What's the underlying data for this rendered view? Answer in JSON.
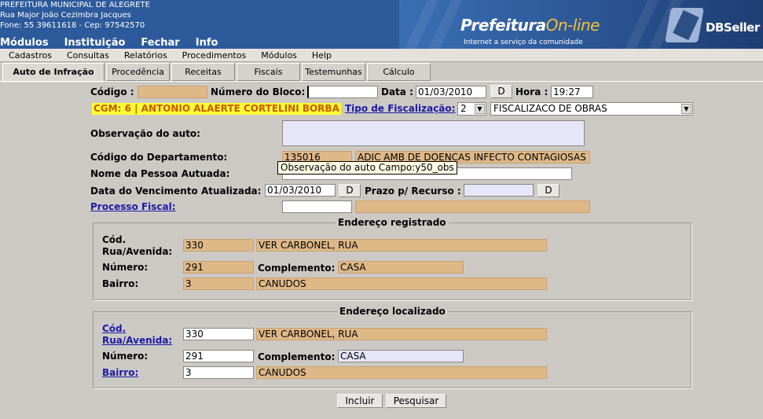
{
  "institution": {
    "name": "PREFEITURA MUNICIPAL DE ALEGRETE",
    "address": "Rua Major João Cezimbra Jacques",
    "contact": "Fone: 55 39611618  -  Cep: 97542570"
  },
  "banner": {
    "logo_main": "Prefeitura",
    "logo_online": "On-line",
    "tagline": "Internet a serviço da comunidade",
    "vendor_logo": "DBSeller"
  },
  "top_menu": [
    "Módulos",
    "Instituição",
    "Fechar",
    "Info"
  ],
  "sub_menu": [
    "Cadastros",
    "Consultas",
    "Relatórios",
    "Procedimentos",
    "Módulos",
    "Help"
  ],
  "tabs": [
    "Auto de Infração",
    "Procedência",
    "Receitas",
    "Fiscais",
    "Testemunhas",
    "Cálculo"
  ],
  "form": {
    "codigo_label": "Código :",
    "codigo_value": "",
    "numero_bloco_label": "Número do Bloco:",
    "numero_bloco_value": "",
    "data_label": "Data :",
    "data_value": "01/03/2010",
    "d_button": "D",
    "hora_label": "Hora :",
    "hora_value": "19:27",
    "cgm_text": "CGM: 6  | ANTONIO ALAERTE CORTELINI BORBA",
    "tipo_fiscalizacao_label": "Tipo de Fiscalização:",
    "tipo_fiscalizacao_code": "2",
    "tipo_fiscalizacao_desc": "FISCALIZACO DE OBRAS",
    "observacao_label": "Observação do auto:",
    "observacao_value": "",
    "departamento_label": "Código do Departamento:",
    "departamento_code": "135016",
    "departamento_desc": "ADIC AMB DE DOENCAS INFECTO CONTAGIOSAS",
    "pessoa_label": "Nome da Pessoa Autuada:",
    "pessoa_value": "",
    "vencimento_label": "Data do Vencimento Atualizada:",
    "vencimento_value": "01/03/2010",
    "prazo_label": "Prazo p/ Recurso :",
    "prazo_value": "",
    "processo_label": "Processo Fiscal:",
    "processo_value": "",
    "processo_desc": ""
  },
  "tooltip": "Observação do auto Campo:y50_obs",
  "endereco_registrado": {
    "legend": "Endereço registrado",
    "rua_label": "Cód. Rua/Avenida:",
    "rua_code": "330",
    "rua_desc": "VER CARBONEL, RUA",
    "numero_label": "Número:",
    "numero_value": "291",
    "complemento_label": "Complemento:",
    "complemento_value": "CASA",
    "bairro_label": "Bairro:",
    "bairro_code": "3",
    "bairro_desc": "CANUDOS"
  },
  "endereco_localizado": {
    "legend": "Endereço localizado",
    "rua_label": "Cód. Rua/Avenida:",
    "rua_code": "330",
    "rua_desc": "VER CARBONEL, RUA",
    "numero_label": "Número:",
    "numero_value": "291",
    "complemento_label": "Complemento:",
    "complemento_value": "CASA",
    "bairro_label": "Bairro:",
    "bairro_code": "3",
    "bairro_desc": "CANUDOS"
  },
  "buttons": {
    "incluir": "Incluir",
    "pesquisar": "Pesquisar"
  },
  "colors": {
    "header": "#2d5a9b",
    "readonly": "#deb887",
    "cgm_bg": "#ffff33",
    "link": "#1a1aa6"
  }
}
